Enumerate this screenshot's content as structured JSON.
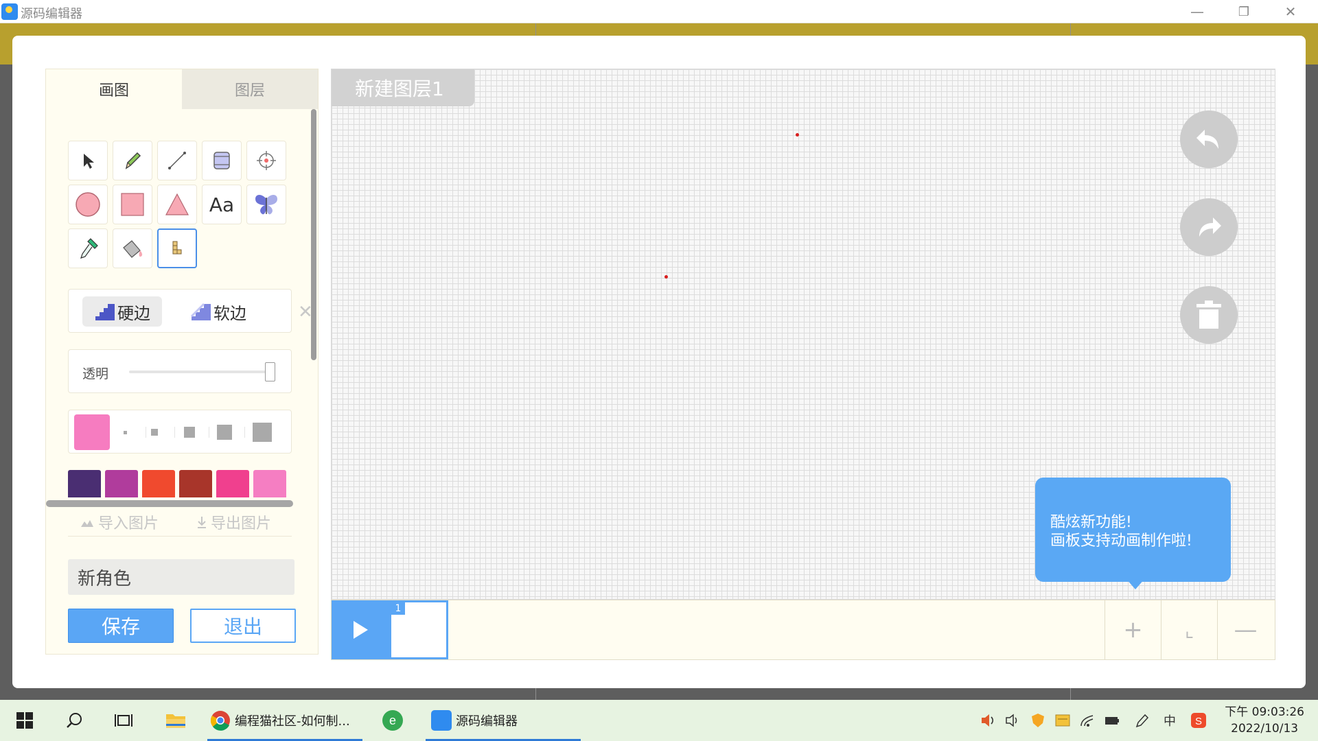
{
  "window": {
    "title": "源码编辑器",
    "controls": {
      "minimize": "—",
      "restore": "❐",
      "close": "✕"
    }
  },
  "panel": {
    "tabs": [
      {
        "label": "画图",
        "active": true
      },
      {
        "label": "图层",
        "active": false
      }
    ],
    "tools": [
      {
        "name": "select-tool",
        "icon": "pointer-icon"
      },
      {
        "name": "pencil-tool",
        "icon": "pencil-icon"
      },
      {
        "name": "line-tool",
        "icon": "line-icon"
      },
      {
        "name": "eraser-tool",
        "icon": "eraser-icon"
      },
      {
        "name": "center-tool",
        "icon": "crosshair-icon"
      },
      {
        "name": "circle-tool",
        "icon": "circle-icon"
      },
      {
        "name": "rectangle-tool",
        "icon": "rectangle-icon"
      },
      {
        "name": "triangle-tool",
        "icon": "triangle-icon"
      },
      {
        "name": "text-tool",
        "icon": "text-icon",
        "label": "Aa"
      },
      {
        "name": "sticker-tool",
        "icon": "butterfly-icon"
      },
      {
        "name": "eyedropper-tool",
        "icon": "eyedropper-icon"
      },
      {
        "name": "fill-tool",
        "icon": "paint-bucket-icon"
      },
      {
        "name": "pixel-tool",
        "icon": "pixel-icon",
        "selected": true
      }
    ],
    "edge": {
      "hard_label": "硬边",
      "soft_label": "软边",
      "selected": "hard",
      "close": "✕"
    },
    "opacity": {
      "label": "透明",
      "value": 1.0
    },
    "brush": {
      "current_color": "#f67cc0",
      "sizes": [
        1,
        2,
        3,
        4,
        5
      ]
    },
    "palette": [
      "#4a2e72",
      "#b03c9c",
      "#f04a2e",
      "#a8352a",
      "#f0408e",
      "#f57ec2"
    ],
    "import_label": "导入图片",
    "export_label": "导出图片",
    "name_field": {
      "value": "新角色"
    },
    "save_label": "保存",
    "exit_label": "退出"
  },
  "canvas": {
    "layer_name": "新建图层1",
    "undo_icon": "undo-icon",
    "redo_icon": "redo-icon",
    "delete_icon": "trash-icon",
    "tooltip_line1": "酷炫新功能!",
    "tooltip_line2": "画板支持动画制作啦!"
  },
  "timeline": {
    "frame_number": "1",
    "add_label": "+",
    "copy_label": "⌞",
    "remove_label": "—"
  },
  "taskbar": {
    "items": [
      {
        "label": "编程猫社区-如何制...",
        "icon": "chrome-icon"
      },
      {
        "label": "源码编辑器",
        "icon": "app-icon"
      }
    ],
    "ime_label": "中",
    "clock_time": "下午 09:03:26",
    "clock_date": "2022/10/13"
  },
  "colors": {
    "accent": "#5aa6f5",
    "panel_bg": "#fffdf1",
    "tooltip": "#5aa8f4"
  }
}
